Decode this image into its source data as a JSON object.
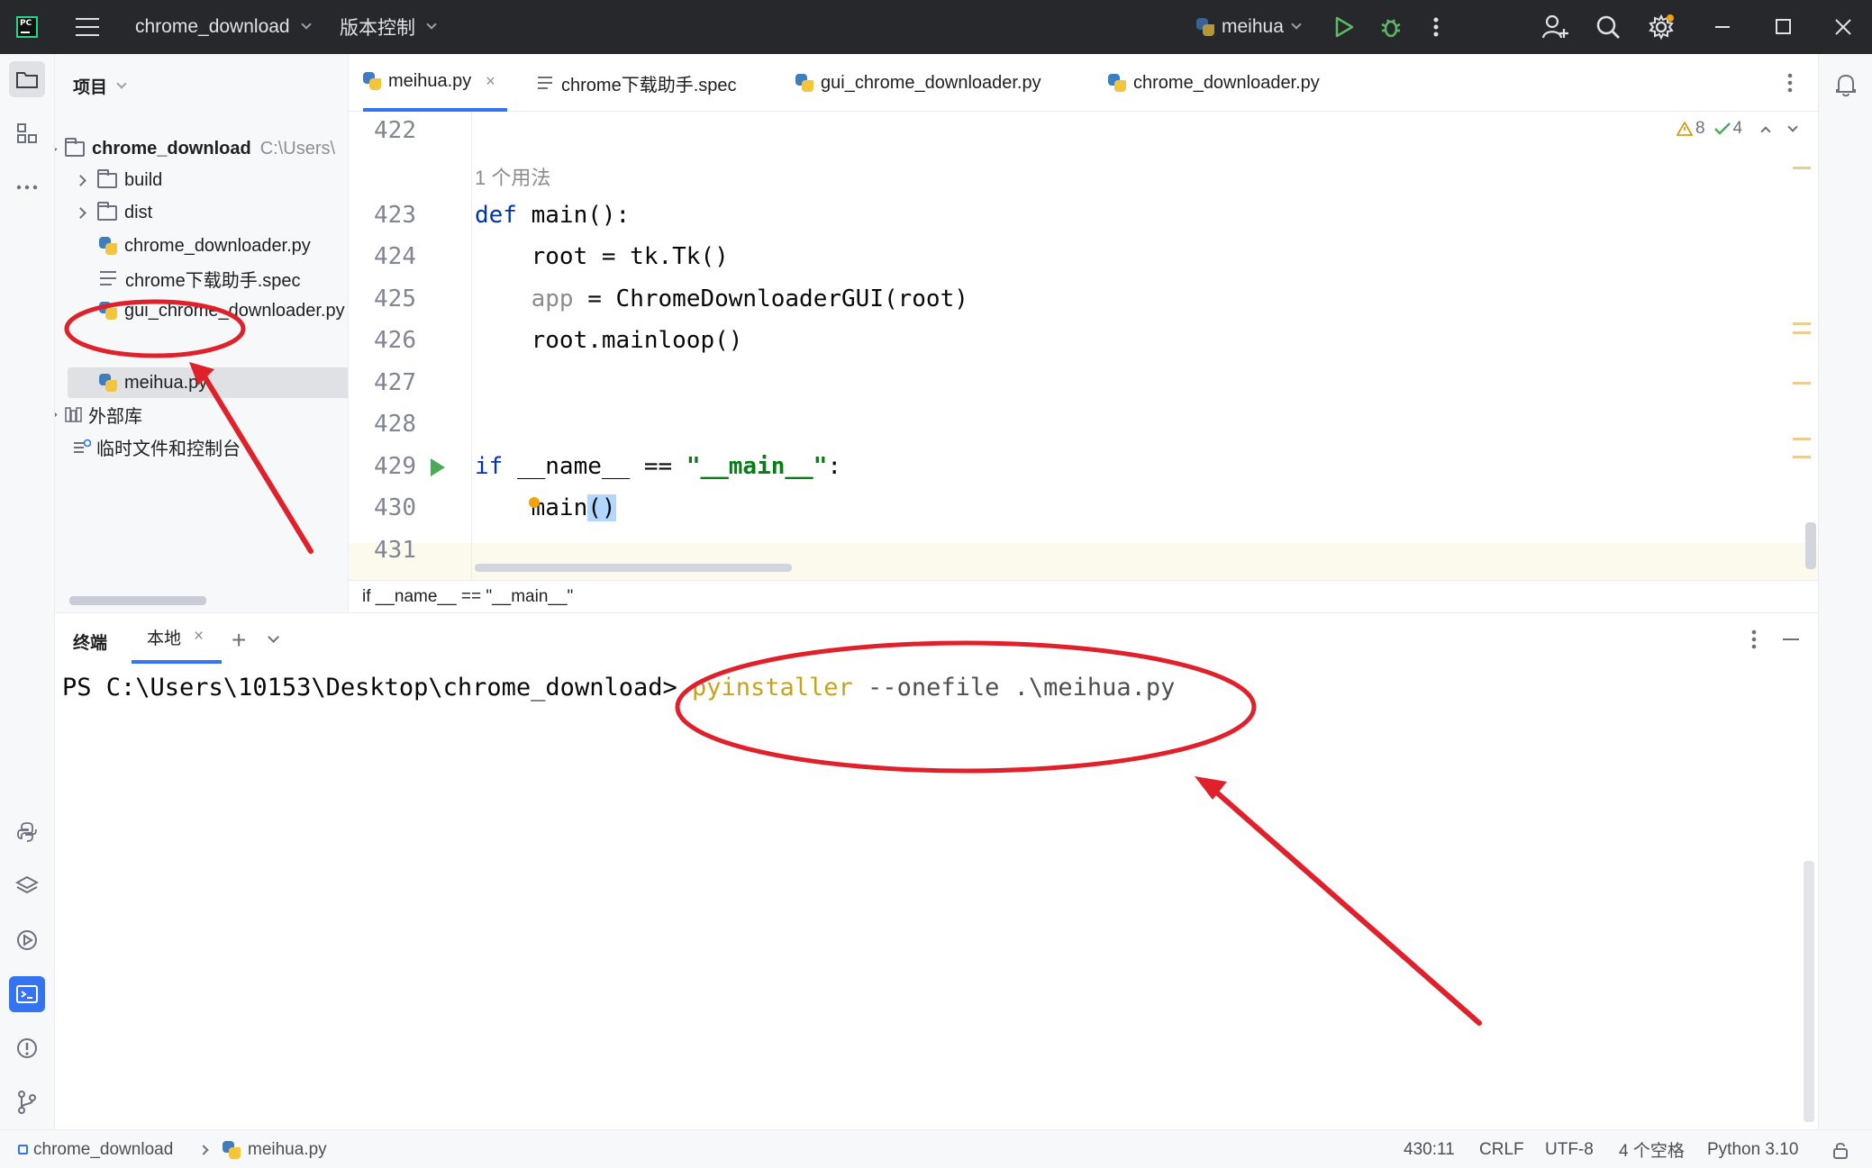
{
  "titlebar": {
    "project_name": "chrome_download",
    "vcs_menu": "版本控制",
    "run_config": "meihua"
  },
  "project_panel": {
    "header": "项目",
    "root_name": "chrome_download",
    "root_path": "C:\\Users\\",
    "items": [
      {
        "label": "build"
      },
      {
        "label": "dist"
      },
      {
        "label": "chrome_downloader.py"
      },
      {
        "label": "chrome下载助手.spec"
      },
      {
        "label": "gui_chrome_downloader.py"
      },
      {
        "label": "meihua.py"
      },
      {
        "label": "外部库"
      },
      {
        "label": "临时文件和控制台"
      }
    ]
  },
  "editor": {
    "tabs": [
      {
        "label": "meihua.py"
      },
      {
        "label": "chrome下载助手.spec"
      },
      {
        "label": "gui_chrome_downloader.py"
      },
      {
        "label": "chrome_downloader.py"
      }
    ],
    "warnings": "8",
    "checks": "4",
    "usage_hint": "1 个用法",
    "lines": {
      "l422": "422",
      "l423": "423",
      "l424": "424",
      "l425": "425",
      "l426": "426",
      "l427": "427",
      "l428": "428",
      "l429": "429",
      "l430": "430",
      "l431": "431"
    },
    "code": {
      "c423_kw": "def",
      "c423_rest": " main():",
      "c424": "    root = tk.Tk()",
      "c425_app": "app",
      "c425_rest": " = ChromeDownloaderGUI(root)",
      "c426": "    root.mainloop()",
      "c429_kw": "if",
      "c429_mid": " __name__ == ",
      "c429_str": "\"__main__\"",
      "c429_end": ":",
      "c430_a": "main",
      "c430_b": "()"
    },
    "breadcrumb": "if __name__ == \"__main__\""
  },
  "terminal": {
    "title": "终端",
    "tab_label": "本地",
    "prompt": "PS C:\\Users\\10153\\Desktop\\chrome_download> ",
    "cmd_program": "pyinstaller",
    "cmd_args": " --onefile .\\meihua.py"
  },
  "statusbar": {
    "crumb_project": "chrome_download",
    "crumb_file": "meihua.py",
    "position": "430:11",
    "line_sep": "CRLF",
    "encoding": "UTF-8",
    "indent": "4 个空格",
    "interpreter": "Python 3.10"
  },
  "colors": {
    "accent": "#3574f0",
    "annotation_red": "#e0202a",
    "keyword": "#0033b3",
    "string": "#067d17",
    "terminal_command": "#c7a31b"
  }
}
